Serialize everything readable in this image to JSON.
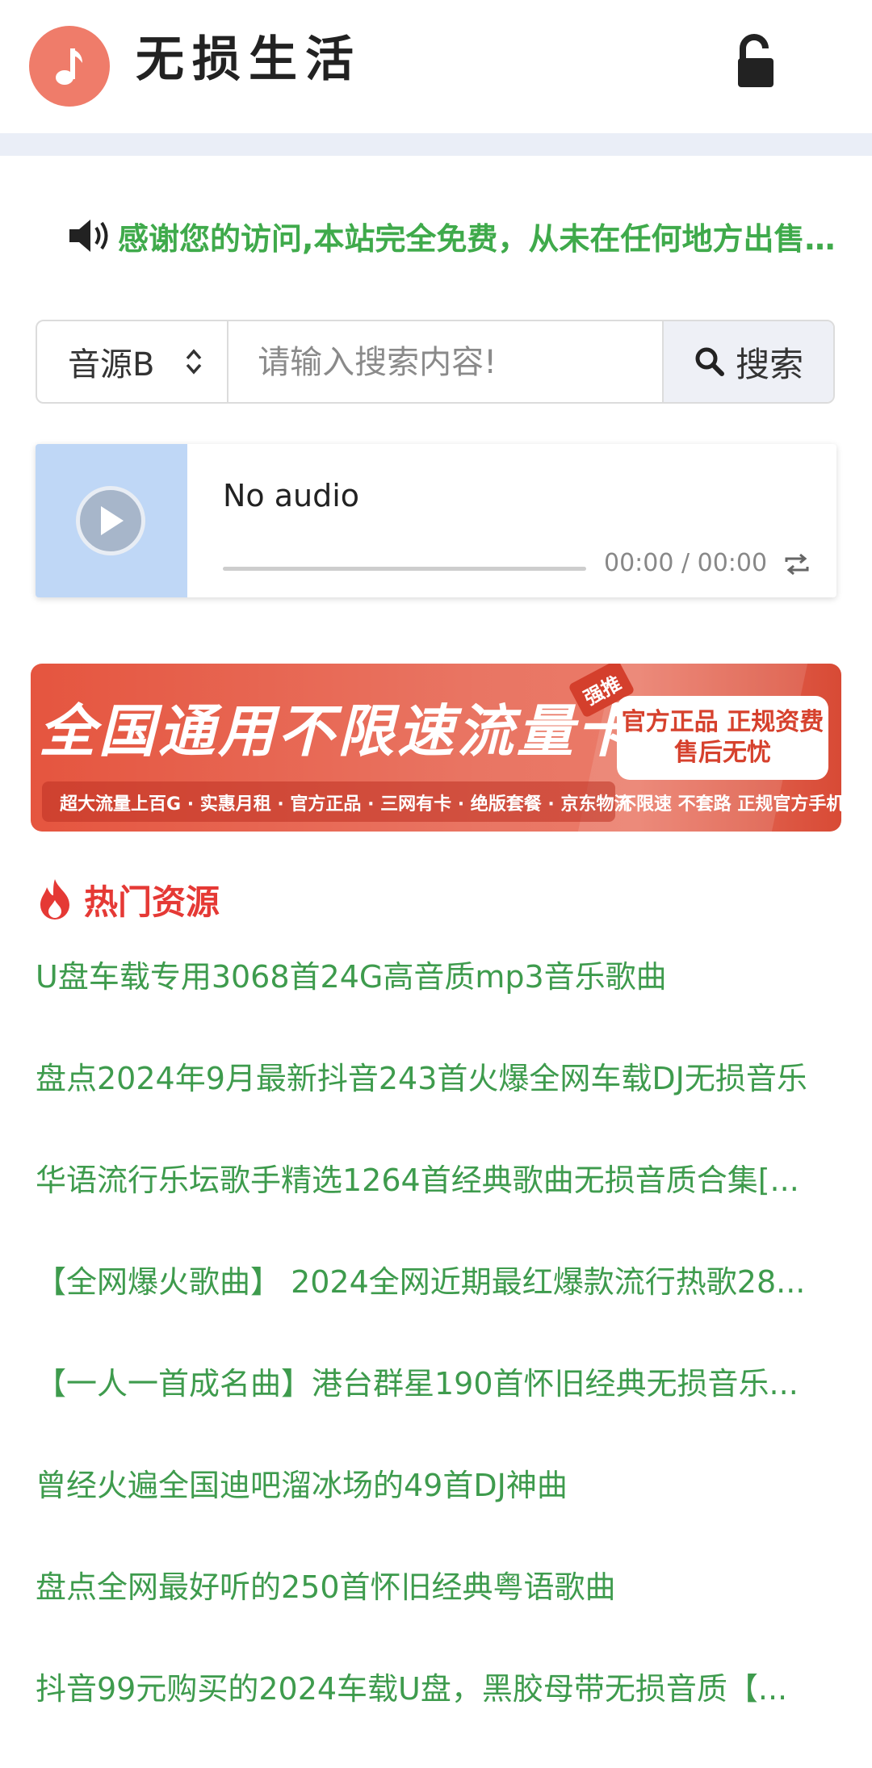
{
  "header": {
    "site_title": "无损生活",
    "logo_icon": "music-note-icon",
    "lock_icon": "unlock-icon",
    "logo_color": "#ef7c6a"
  },
  "notice": {
    "icon": "speaker-icon",
    "text": "感谢您的访问,本站完全免费，从未在任何地方出售本站资源",
    "color": "#3faa4b"
  },
  "search": {
    "source_selected": "音源B",
    "placeholder": "请输入搜索内容!",
    "button_label": "搜索"
  },
  "player": {
    "title": "No audio",
    "time": "00:00 / 00:00",
    "progress": 0
  },
  "ad": {
    "headline": "全国通用不限速流量卡",
    "stamp": "强推",
    "pill_line1": "官方正品 正规资费",
    "pill_line2": "售后无忧",
    "subline": "超大流量上百G · 实惠月租 · 官方正品 · 三网有卡 · 绝版套餐 · 京东物流",
    "subright": "不限速  不套路  正规官方手机卡"
  },
  "hot": {
    "title": "热门资源",
    "icon": "fire-icon",
    "title_color": "#e53935",
    "items": [
      "U盘车载专用3068首24G高音质mp3音乐歌曲",
      "盘点2024年9月最新抖音243首火爆全网车载DJ无损音乐",
      "华语流行乐坛歌手精选1264首经典歌曲无损音质合集[...",
      "【全网爆火歌曲】 2024全网近期最红爆款流行热歌28...",
      "【一人一首成名曲】港台群星190首怀旧经典无损音乐...",
      "曾经火遍全国迪吧溜冰场的49首DJ神曲",
      "盘点全网最好听的250首怀旧经典粤语歌曲",
      "抖音99元购买的2024车载U盘，黑胶母带无损音质【..."
    ]
  }
}
